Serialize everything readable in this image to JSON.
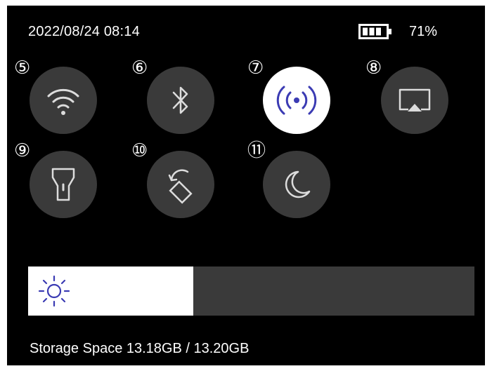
{
  "status_bar": {
    "datetime": "2022/08/24 08:14",
    "battery_percent_label": "71%",
    "battery_icon": "battery-icon"
  },
  "quick_settings": [
    {
      "badge": "⑤",
      "name": "wifi",
      "icon": "wifi-icon",
      "active": false
    },
    {
      "badge": "⑥",
      "name": "bluetooth",
      "icon": "bluetooth-icon",
      "active": false
    },
    {
      "badge": "⑦",
      "name": "hotspot",
      "icon": "hotspot-icon",
      "active": true
    },
    {
      "badge": "⑧",
      "name": "screen-cast",
      "icon": "screen-cast-icon",
      "active": false
    },
    {
      "badge": "⑨",
      "name": "flashlight",
      "icon": "flashlight-icon",
      "active": false
    },
    {
      "badge": "⑩",
      "name": "auto-rotate",
      "icon": "rotate-icon",
      "active": false
    },
    {
      "badge": "⑪",
      "name": "dark-mode",
      "icon": "moon-icon",
      "active": false
    }
  ],
  "brightness": {
    "level_fraction": 0.37,
    "icon": "sun-icon"
  },
  "storage": {
    "label": "Storage Space 13.18GB / 13.20GB"
  },
  "colors": {
    "background": "#000000",
    "tile": "#3a3a3a",
    "tile_active": "#ffffff",
    "hotspot_accent": "#3b3bb3",
    "icon": "#dcdcdc"
  }
}
